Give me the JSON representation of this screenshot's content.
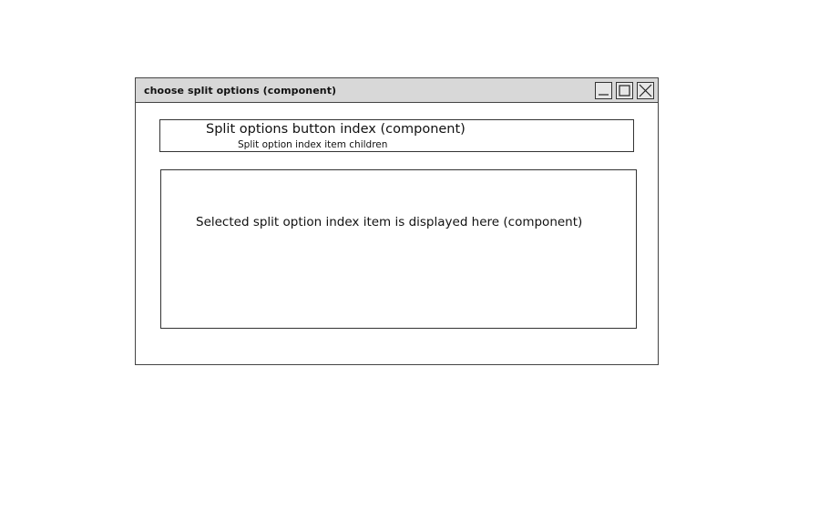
{
  "window": {
    "title": "choose split options (component)",
    "controls": {
      "minimize": "minimize-icon",
      "maximize": "maximize-icon",
      "close": "close-icon"
    }
  },
  "split_options": {
    "button_index_label": "Split options button index (component)",
    "children_label": "Split option index item children"
  },
  "selected_item": {
    "label": "Selected split option index item is displayed here (component)"
  },
  "colors": {
    "titlebar": "#d8d8d8",
    "border": "#333333",
    "background": "#ffffff"
  }
}
